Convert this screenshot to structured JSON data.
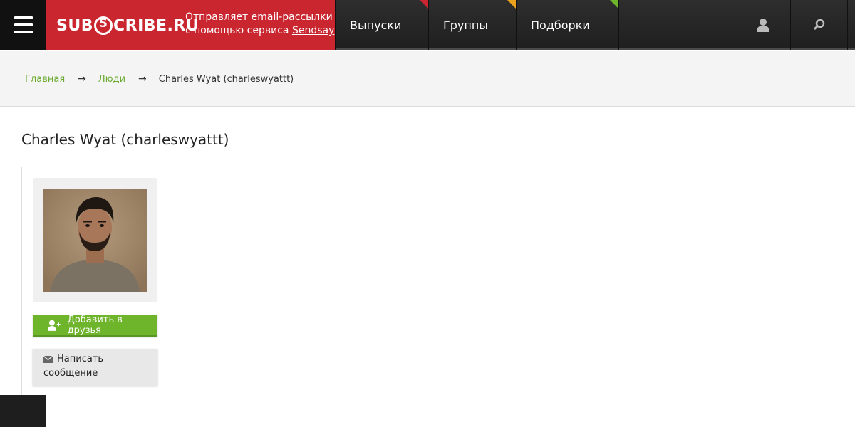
{
  "header": {
    "logo_text_left": "SUB",
    "logo_text_right": "CRIBE.RU",
    "tagline_line1": "Отправляет email-рассылки",
    "tagline_line2": "с помощью сервиса",
    "tagline_link": "Sendsay",
    "nav": [
      {
        "label": "Выпуски",
        "accent": "#c9262f"
      },
      {
        "label": "Группы",
        "accent": "#e8a21c"
      },
      {
        "label": "Подборки",
        "accent": "#6fb52c"
      }
    ],
    "icons": [
      "user-icon",
      "search-icon"
    ]
  },
  "breadcrumb": {
    "home": "Главная",
    "people": "Люди",
    "current": "Charles Wyat (charleswyattt)"
  },
  "profile": {
    "title": "Charles Wyat (charleswyattt)",
    "add_friend": "Добавить в друзья",
    "message_line1": "Написать",
    "message_line2": "сообщение"
  },
  "colors": {
    "brand_red": "#c9262f",
    "link_green": "#6aaa2e",
    "button_green": "#6fb52c"
  }
}
